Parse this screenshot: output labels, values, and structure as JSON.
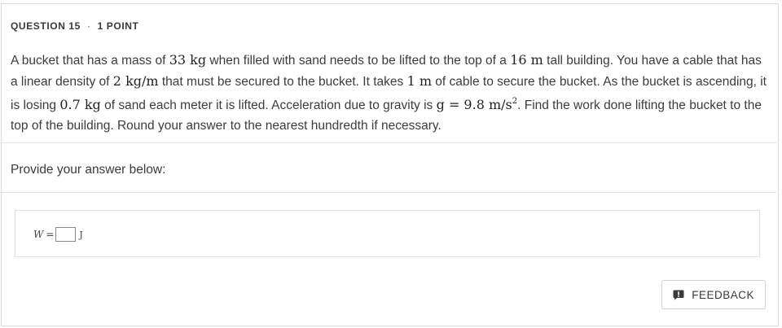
{
  "header": {
    "question_label": "QUESTION 15",
    "separator": "·",
    "points": "1 POINT"
  },
  "prompt": {
    "t1": "A bucket that has a mass of ",
    "m1": "33 kg",
    "t2": " when filled with sand needs to be lifted to the top of a ",
    "m2": "16 m",
    "t3": " tall building. You have a cable that has a linear density of ",
    "m3": "2 kg/m",
    "t4": " that must be secured to the bucket. It takes ",
    "m4": "1 m",
    "t5": " of cable to secure the bucket. As the bucket is ascending, it is losing ",
    "m5": "0.7 kg",
    "t6": " of sand each meter it is lifted. Acceleration due to gravity is ",
    "m6": "g = 9.8 m/s",
    "m6_exp": "2",
    "t7": ". Find the work done lifting the bucket to the top of the building. Round your answer to the nearest hundredth if necessary."
  },
  "answer": {
    "label": "Provide your answer below:",
    "variable": "W",
    "equals": "=",
    "value": "",
    "unit": "J"
  },
  "feedback": {
    "label": "FEEDBACK",
    "icon": "feedback-bubble-icon"
  },
  "colors": {
    "border": "#dcdcdc",
    "text": "#3c3c3c",
    "icon": "#3a3a3a"
  }
}
